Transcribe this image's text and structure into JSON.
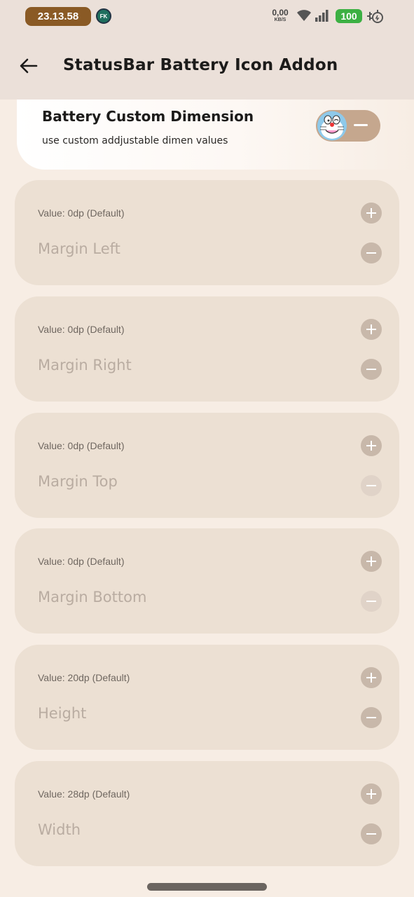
{
  "status_bar": {
    "time": "23.13.58",
    "app_badge": "FK",
    "net_speed_value": "0,00",
    "net_speed_unit": "KB/S",
    "battery_level": "100"
  },
  "app_bar": {
    "title": "StatusBar Battery Icon Addon"
  },
  "header": {
    "title": "Battery Custom Dimension",
    "subtitle": "use custom addjustable dimen values",
    "toggle_on": true
  },
  "cards": [
    {
      "value": "Value: 0dp (Default)",
      "label": "Margin Left"
    },
    {
      "value": "Value: 0dp (Default)",
      "label": "Margin Right"
    },
    {
      "value": "Value: 0dp (Default)",
      "label": "Margin Top"
    },
    {
      "value": "Value: 0dp (Default)",
      "label": "Margin Bottom"
    },
    {
      "value": "Value: 20dp (Default)",
      "label": "Height"
    },
    {
      "value": "Value: 28dp (Default)",
      "label": "Width"
    }
  ],
  "colors": {
    "background": "#f7ede4",
    "card": "#ece0d3",
    "accent": "#c5a78e",
    "battery": "#3cb043",
    "clock": "#8a5a25"
  }
}
